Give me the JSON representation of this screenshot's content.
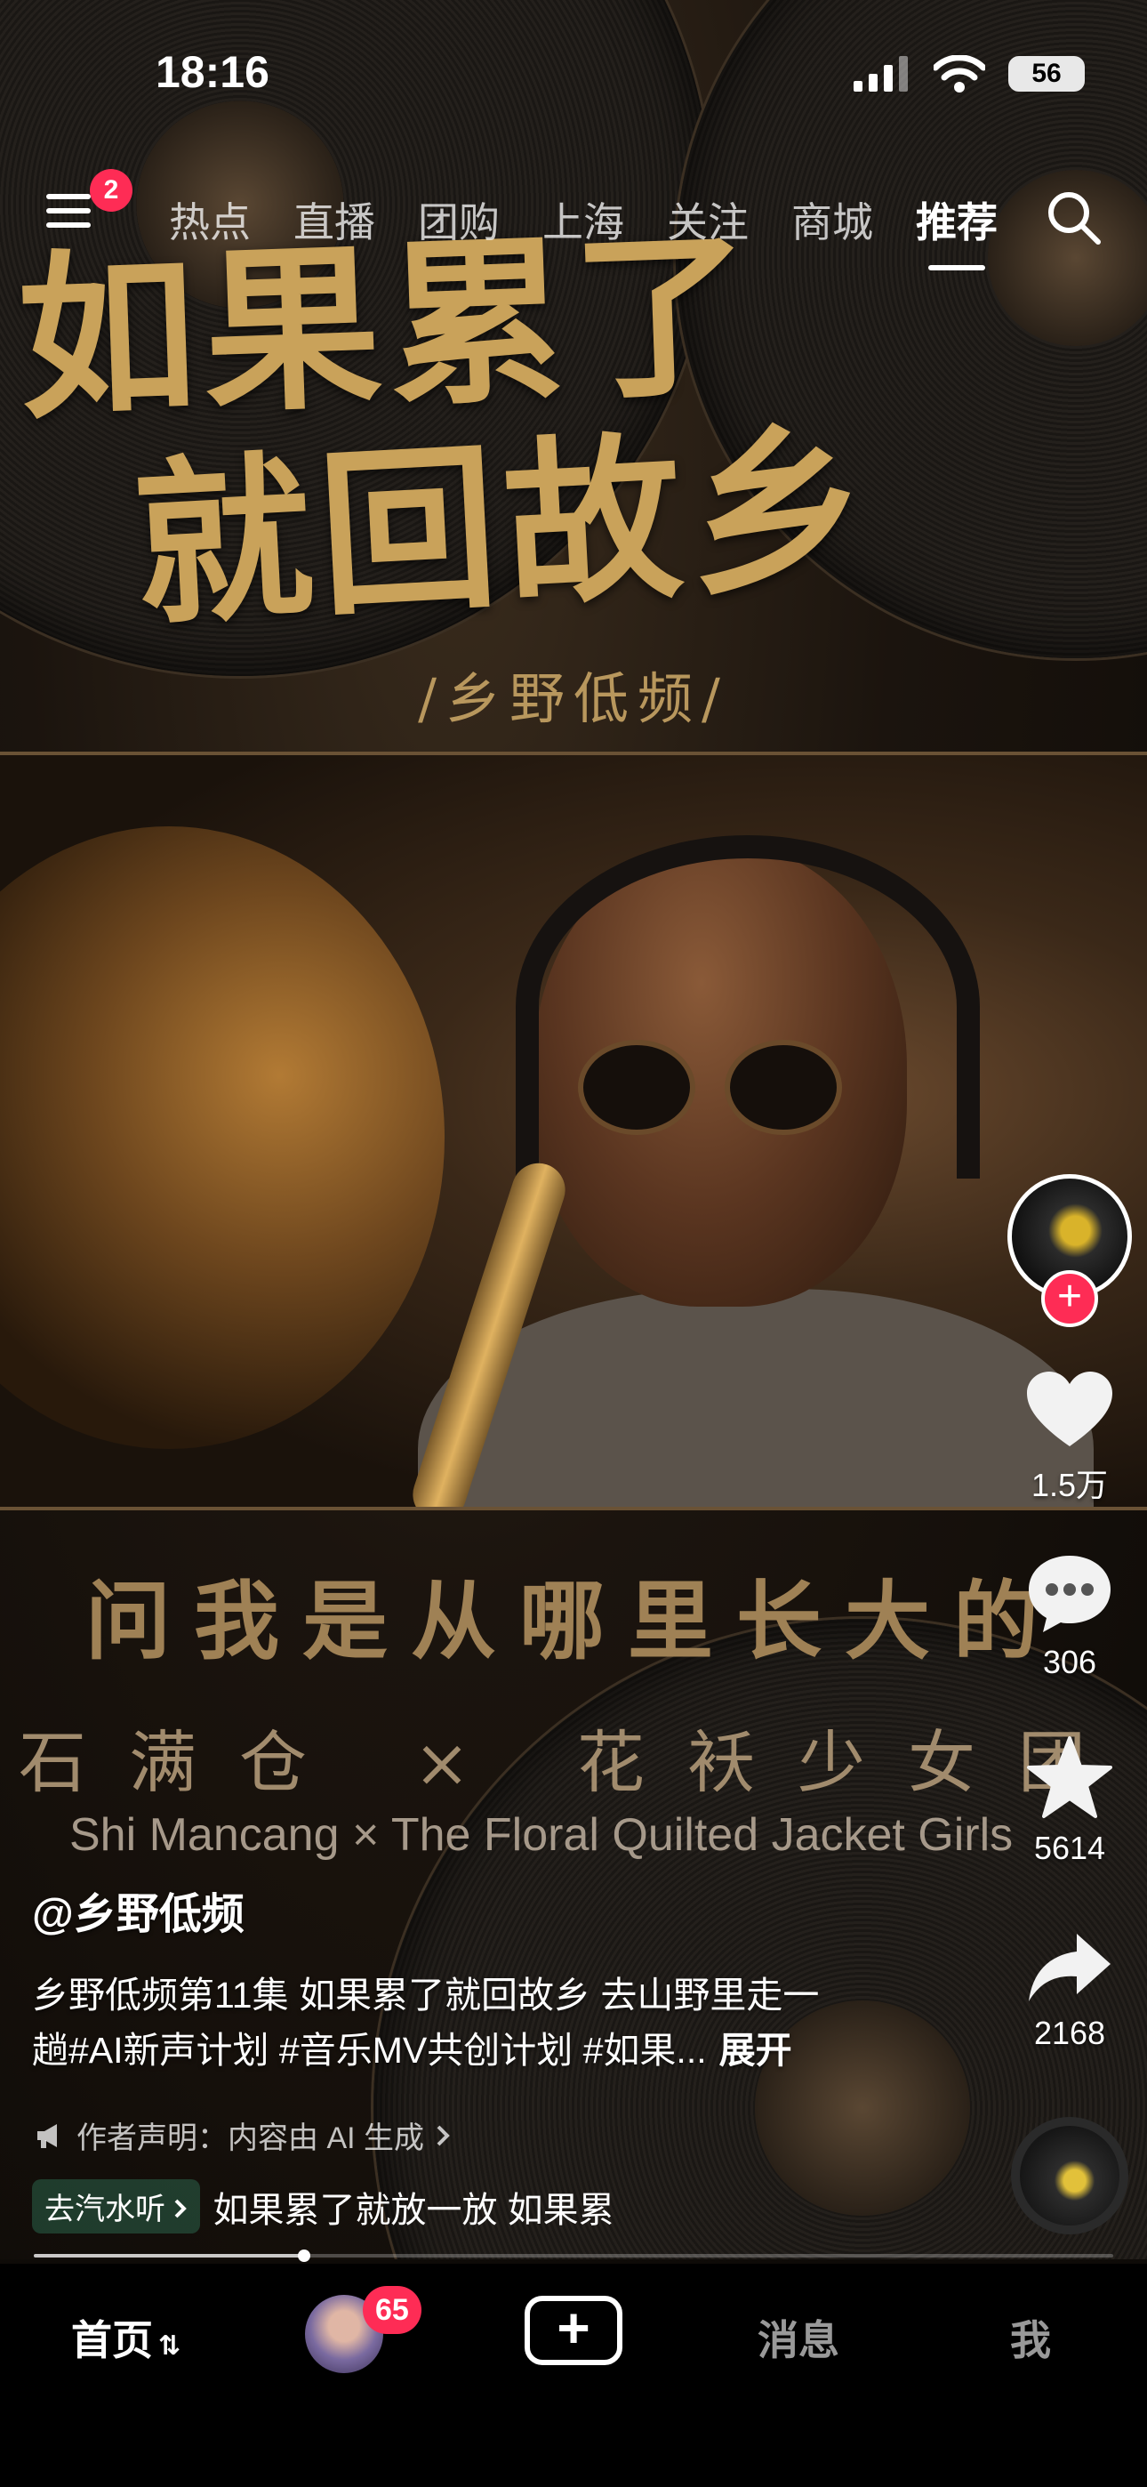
{
  "status_bar": {
    "time": "18:16",
    "battery": "56"
  },
  "top_nav": {
    "menu_badge": "2",
    "tabs": [
      {
        "label": "热点"
      },
      {
        "label": "直播"
      },
      {
        "label": "团购"
      },
      {
        "label": "上海"
      },
      {
        "label": "关注"
      },
      {
        "label": "商城"
      },
      {
        "label": "推荐",
        "active": true
      }
    ]
  },
  "video": {
    "headline_line1": "如果累了",
    "headline_line2": "就回故乡",
    "brand_sub": "/乡野低频/",
    "lyric": "问我是从哪里长大的",
    "artists_cn": "石满仓 × 花袄少女团",
    "artists_en": "Shi Mancang × The Floral Quilted Jacket Girls"
  },
  "actions": {
    "likes": "1.5万",
    "comments": "306",
    "favorites": "5614",
    "shares": "2168"
  },
  "caption": {
    "author": "@乡野低频",
    "description_line1": "乡野低频第11集 如果累了就回故乡 去山野里走一",
    "description_line2": "趟#AI新声计划 #音乐MV共创计划 #如果...",
    "expand_label": "展开",
    "disclaimer": "作者声明：内容由 AI 生成",
    "soda_tag": "去汽水听",
    "song_marquee": "如果累了就放一放  如果累"
  },
  "progress": {
    "fraction": 0.25
  },
  "bottom_nav": {
    "home": "首页",
    "friend_badge": "65",
    "messages": "消息",
    "me": "我"
  },
  "colors": {
    "accent": "#fe2c55",
    "headline_gold": "#c9a25a"
  }
}
